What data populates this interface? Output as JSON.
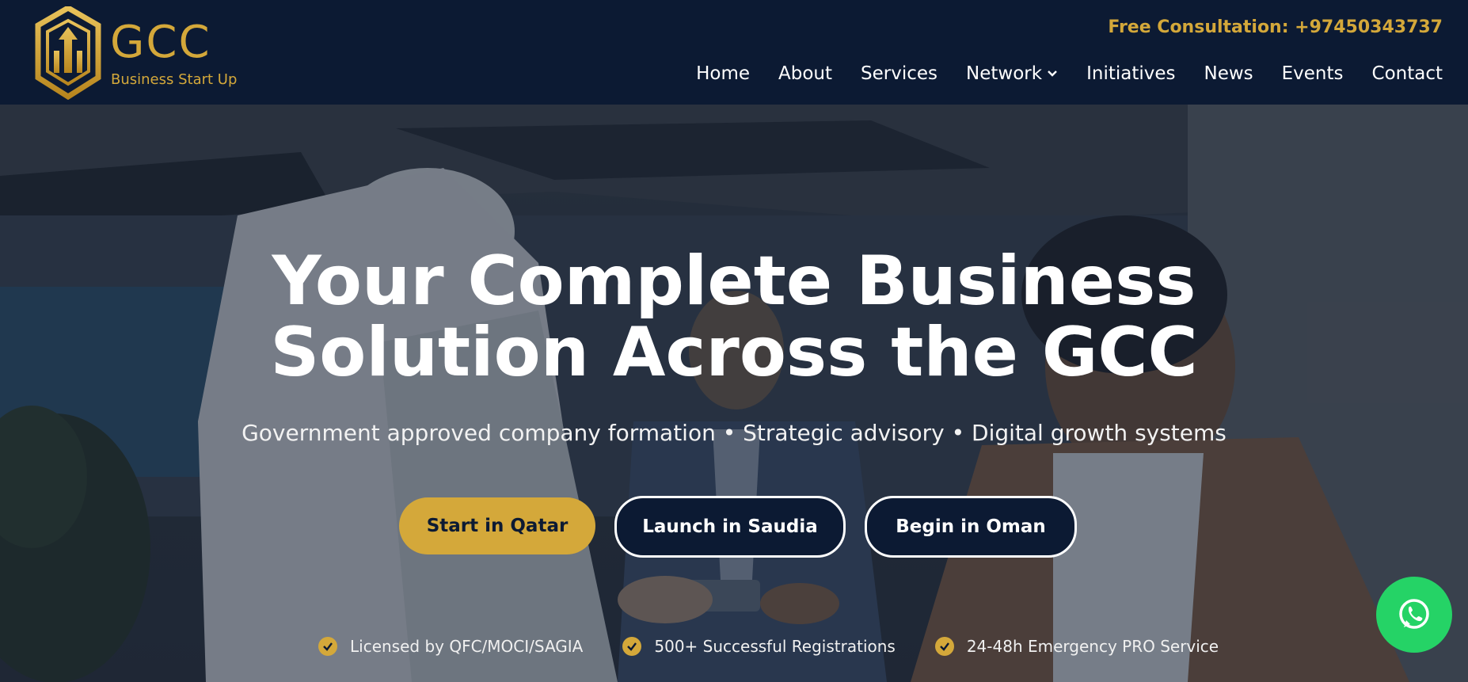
{
  "brand": {
    "name": "GCC",
    "tagline": "Business Start Up",
    "logo_icon": "hexagon-arrows-logo",
    "accent_color": "#d4a83a",
    "header_bg": "#0c1a33"
  },
  "header": {
    "phone_label": "Free Consultation: +97450343737"
  },
  "nav": {
    "items": [
      {
        "label": "Home"
      },
      {
        "label": "About"
      },
      {
        "label": "Services"
      },
      {
        "label": "Network",
        "icon": "chevron-down-icon"
      },
      {
        "label": "Initiatives"
      },
      {
        "label": "News"
      },
      {
        "label": "Events"
      },
      {
        "label": "Contact"
      }
    ]
  },
  "hero": {
    "title_line1": "Your Complete Business",
    "title_line2": "Solution Across the GCC",
    "subtitle": "Government approved company formation • Strategic advisory • Digital growth systems",
    "buttons": [
      {
        "label": "Start in Qatar"
      },
      {
        "label": "Launch in Saudia"
      },
      {
        "label": "Begin in Oman"
      }
    ],
    "features": [
      {
        "label": "Licensed by QFC/MOCI/SAGIA",
        "icon": "check-circle-icon"
      },
      {
        "label": "500+ Successful Registrations",
        "icon": "check-circle-icon"
      },
      {
        "label": "24-48h Emergency PRO Service",
        "icon": "check-circle-icon"
      }
    ]
  },
  "whatsapp": {
    "icon": "whatsapp-icon",
    "color": "#25d366"
  }
}
